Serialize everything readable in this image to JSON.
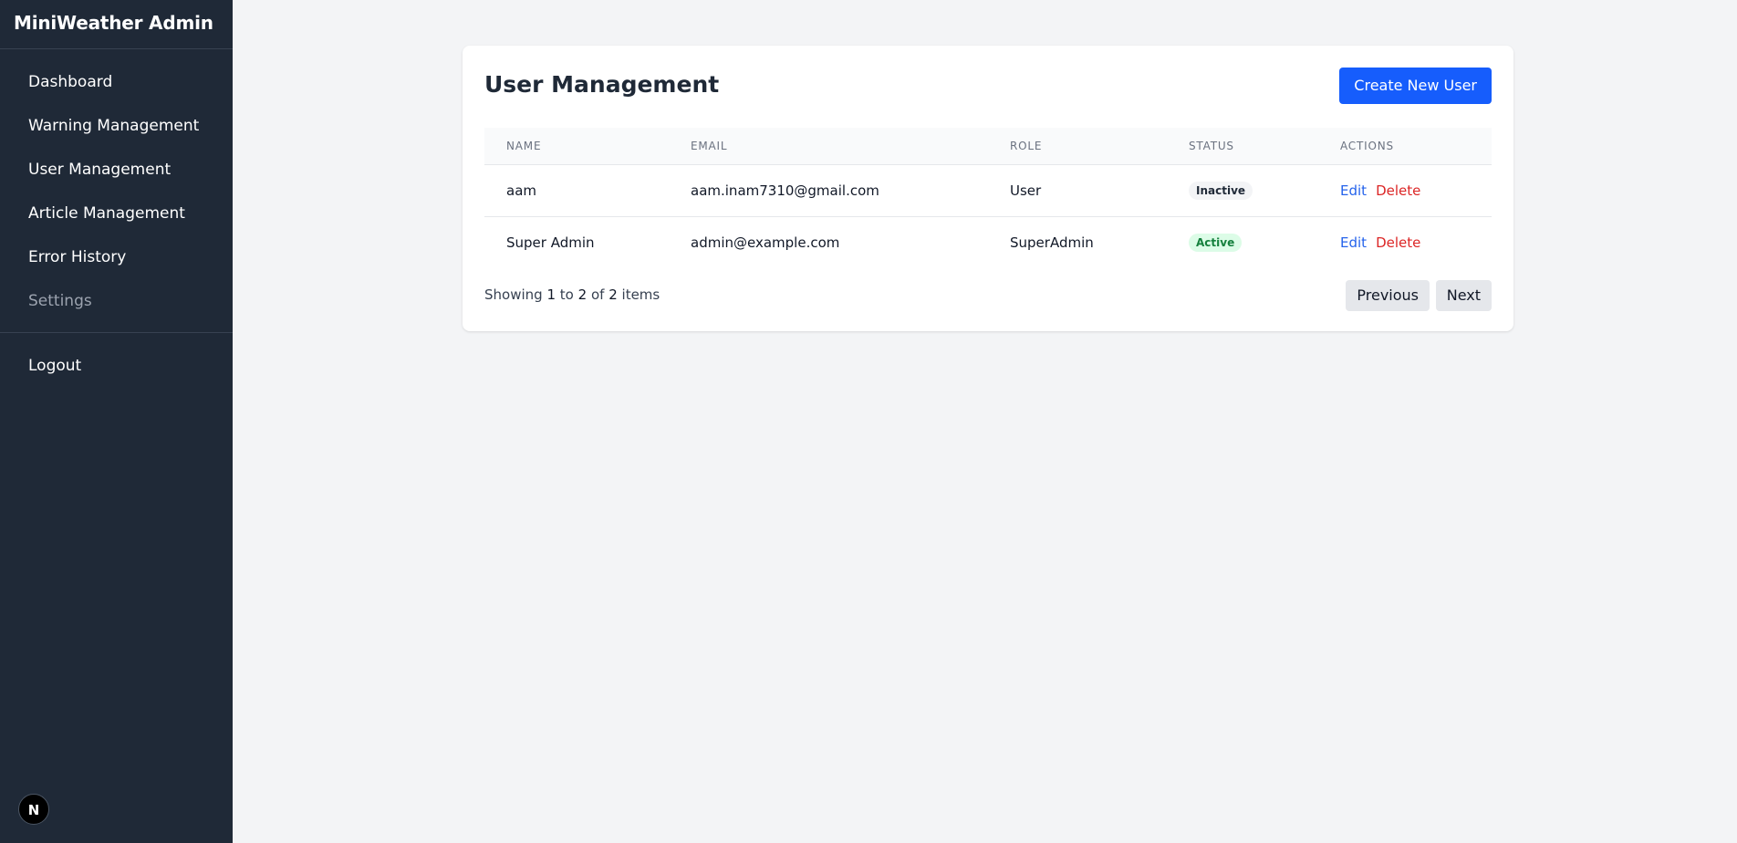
{
  "sidebar": {
    "brand": "MiniWeather Admin",
    "items": [
      {
        "label": "Dashboard"
      },
      {
        "label": "Warning Management"
      },
      {
        "label": "User Management"
      },
      {
        "label": "Article Management"
      },
      {
        "label": "Error History"
      },
      {
        "label": "Settings"
      }
    ],
    "logout": "Logout",
    "badge": "N"
  },
  "main": {
    "title": "User Management",
    "create_button": "Create New User",
    "table": {
      "headers": [
        "NAME",
        "EMAIL",
        "ROLE",
        "STATUS",
        "ACTIONS"
      ],
      "rows": [
        {
          "name": "aam",
          "email": "aam.inam7310@gmail.com",
          "role": "User",
          "status": "Inactive",
          "edit": "Edit",
          "delete": "Delete"
        },
        {
          "name": "Super Admin",
          "email": "admin@example.com",
          "role": "SuperAdmin",
          "status": "Active",
          "edit": "Edit",
          "delete": "Delete"
        }
      ]
    },
    "pagination": {
      "showing": "Showing",
      "from": "1",
      "to_word": "to",
      "to": "2",
      "of_word": "of",
      "total": "2",
      "items_word": "items",
      "previous": "Previous",
      "next": "Next"
    }
  },
  "colors": {
    "sidebar_bg": "#1f2937",
    "accent": "#165dfc",
    "active_badge_bg": "#dcfce7",
    "active_badge_text": "#15803d",
    "delete_text": "#dc2626"
  }
}
